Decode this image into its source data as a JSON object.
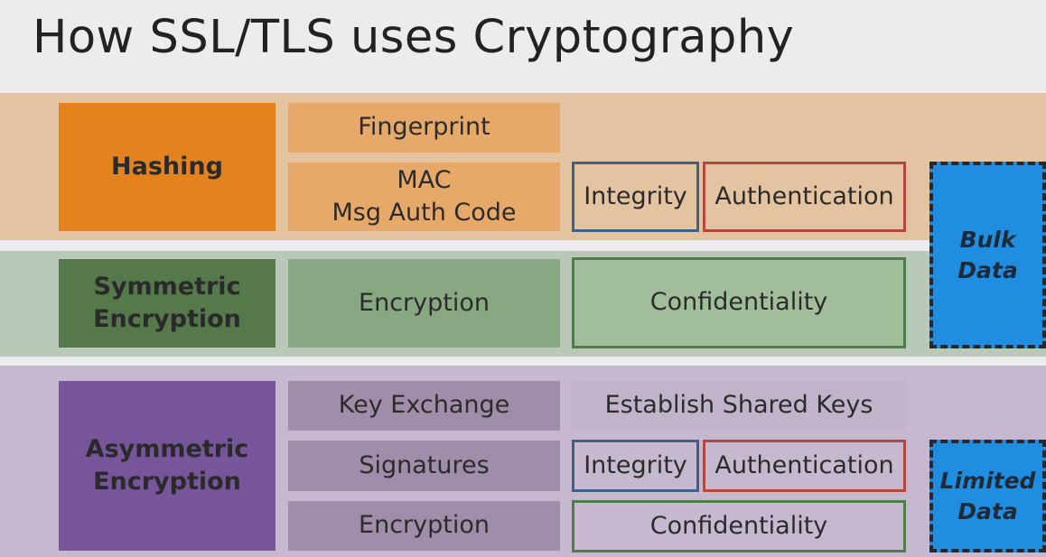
{
  "title": "How SSL/TLS uses Cryptography",
  "rows": {
    "hashing": {
      "label": "Hashing",
      "uses": [
        "Fingerprint",
        "MAC\nMsg Auth Code"
      ],
      "goals": [
        "Integrity",
        "Authentication"
      ]
    },
    "symmetric": {
      "label": "Symmetric\nEncryption",
      "uses": [
        "Encryption"
      ],
      "goals": [
        "Confidentiality"
      ]
    },
    "asymmetric": {
      "label": "Asymmetric\nEncryption",
      "uses": [
        "Key Exchange",
        "Signatures",
        "Encryption"
      ],
      "goals": [
        "Establish Shared Keys",
        "Integrity",
        "Authentication",
        "Confidentiality"
      ]
    }
  },
  "data_notes": {
    "bulk": "Bulk\nData",
    "limited": "Limited\nData"
  },
  "colors": {
    "hashing_band": "#e4c3a1",
    "hashing_main": "#e4831e",
    "hashing_cell": "#e7a96a",
    "symmetric_band": "#b9c8b9",
    "symmetric_main": "#55794a",
    "symmetric_cell": "#87a880",
    "symmetric_goal": "#a2bd9a",
    "asymmetric_band": "#c5b8cf",
    "asymmetric_main": "#76559b",
    "asymmetric_cell": "#9f8da9",
    "asymmetric_goal": "#c0b3ca",
    "integrity_border": "#3f6185",
    "authentication_border": "#b3483e",
    "confidentiality_border": "#4e7d47",
    "data_box": "#1f8ee0"
  }
}
